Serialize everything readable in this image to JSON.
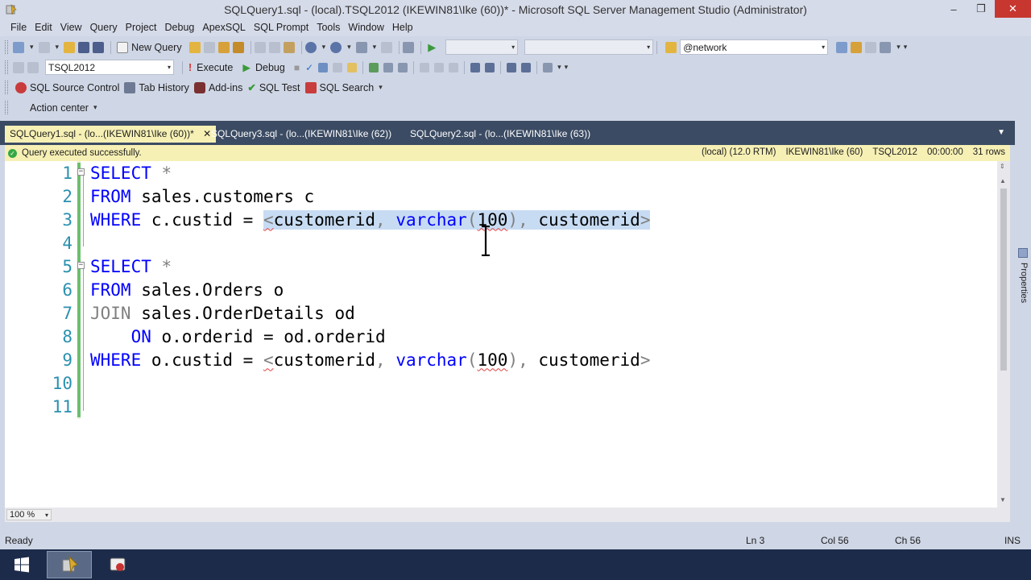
{
  "window": {
    "title": "SQLQuery1.sql - (local).TSQL2012 (IKEWIN81\\Ike (60))* - Microsoft SQL Server Management Studio (Administrator)",
    "buttons": [
      "–",
      "❐",
      "✕"
    ]
  },
  "menu": [
    "File",
    "Edit",
    "View",
    "Query",
    "Project",
    "Debug",
    "ApexSQL",
    "SQL Prompt",
    "Tools",
    "Window",
    "Help"
  ],
  "toolbar1": {
    "new_query": "New Query",
    "search_combo": "@network"
  },
  "toolbar2": {
    "database": "TSQL2012",
    "execute": "Execute",
    "debug": "Debug"
  },
  "toolbar3": {
    "source_control": "SQL Source Control",
    "tab_history": "Tab History",
    "addins": "Add-ins",
    "sql_test": "SQL Test",
    "sql_search": "SQL Search"
  },
  "toolbar4": {
    "action_center": "Action center"
  },
  "tabs": [
    {
      "label": "SQLQuery1.sql - (lo...(IKEWIN81\\Ike (60))*",
      "active": true
    },
    {
      "label": "SQLQuery3.sql - (lo...(IKEWIN81\\Ike (62))",
      "active": false
    },
    {
      "label": "SQLQuery2.sql - (lo...(IKEWIN81\\Ike (63))",
      "active": false
    }
  ],
  "side_panel": {
    "label": "Properties"
  },
  "infobar": {
    "message": "Query executed successfully.",
    "server": "(local) (12.0 RTM)",
    "user": "IKEWIN81\\Ike (60)",
    "database": "TSQL2012",
    "elapsed": "00:00:00",
    "rows": "31 rows"
  },
  "editor": {
    "line_numbers": [
      "1",
      "2",
      "3",
      "4",
      "5",
      "6",
      "7",
      "8",
      "9",
      "10",
      "11"
    ],
    "lines": {
      "l1": {
        "kw": "SELECT",
        "rest": " *"
      },
      "l2": {
        "kw": "FROM",
        "rest": " sales.customers c"
      },
      "l3": {
        "kw": "WHERE",
        "pre": " c.custid = ",
        "lt": "<",
        "p1": "customerid",
        "c1": ", ",
        "tp": "varchar",
        "op": "(",
        "num": "100",
        "cp": ")",
        "c2": ", ",
        "p2": "customerid",
        "gt": ">"
      },
      "l5": {
        "kw": "SELECT",
        "rest": " *"
      },
      "l6": {
        "kw": "FROM",
        "rest": " sales.Orders o"
      },
      "l7": {
        "kw": "JOIN",
        "rest": " sales.OrderDetails od"
      },
      "l8": {
        "indent": "    ",
        "kw": "ON",
        "rest": " o.orderid = od.orderid"
      },
      "l9": {
        "kw": "WHERE",
        "pre": " o.custid = ",
        "lt": "<",
        "p1": "customerid",
        "c1": ", ",
        "tp": "varchar",
        "op": "(",
        "num": "100",
        "cp": ")",
        "c2": ", ",
        "p2": "customerid",
        "gt": ">"
      }
    },
    "zoom": "100 %"
  },
  "status": {
    "state": "Ready",
    "ln": "Ln 3",
    "col": "Col 56",
    "ch": "Ch 56",
    "mode": "INS"
  },
  "colors": {
    "keyword": "#0000ff",
    "line_number": "#2b91af",
    "selection": "#c7dcf3",
    "tab_active": "#f6f0b5",
    "tab_strip": "#3b4b63"
  }
}
